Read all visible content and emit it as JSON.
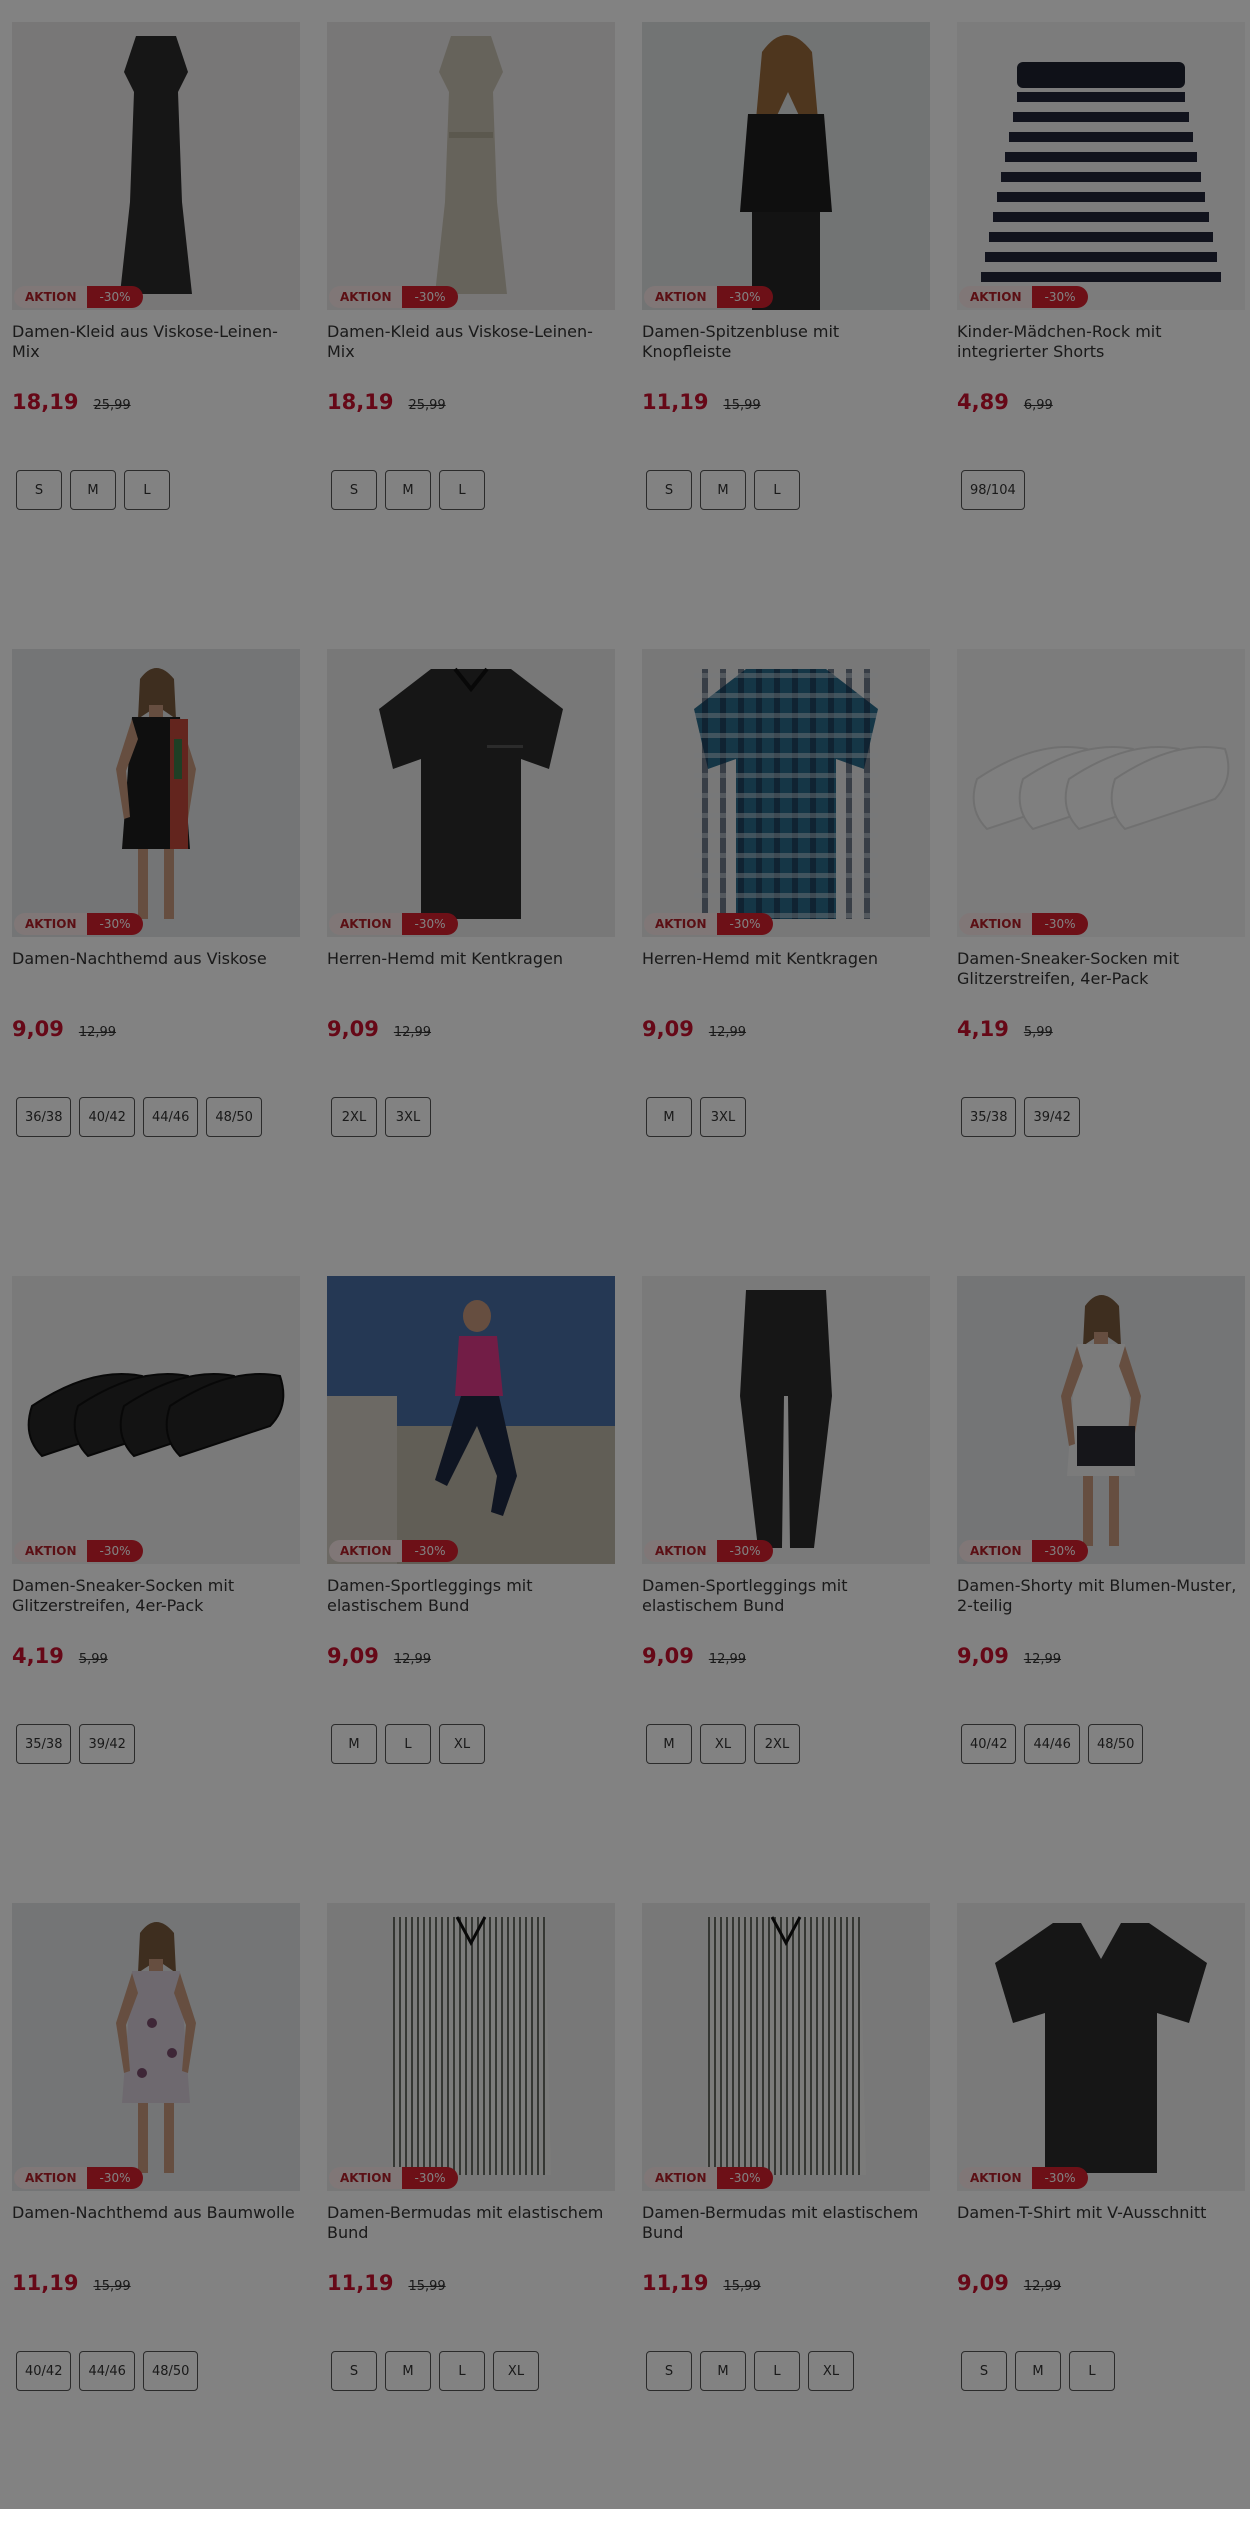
{
  "products": [
    {
      "title": "Damen-Kleid aus Viskose-Leinen-Mix",
      "badge": "AKTION",
      "discount": "-30%",
      "price": "18,19",
      "old_price": "25,99",
      "sizes": [
        "S",
        "M",
        "L"
      ],
      "image": {
        "icon": "black-dress-image",
        "bg": "#eceaea"
      }
    },
    {
      "title": "Damen-Kleid aus Viskose-Leinen-Mix",
      "badge": "AKTION",
      "discount": "-30%",
      "price": "18,19",
      "old_price": "25,99",
      "sizes": [
        "S",
        "M",
        "L"
      ],
      "image": {
        "icon": "beige-dress-image",
        "bg": "#eceaea"
      }
    },
    {
      "title": "Damen-Spitzenbluse mit Knopfleiste",
      "badge": "AKTION",
      "discount": "-30%",
      "price": "11,19",
      "old_price": "15,99",
      "sizes": [
        "S",
        "M",
        "L"
      ],
      "image": {
        "icon": "lace-blouse-model-image",
        "bg": "#dfe3e4"
      }
    },
    {
      "title": "Kinder-Mädchen-Rock mit integrierter Shorts",
      "badge": "AKTION",
      "discount": "-30%",
      "price": "4,89",
      "old_price": "6,99",
      "sizes": [
        "98/104"
      ],
      "image": {
        "icon": "striped-skirt-image",
        "bg": "#f3f3f3"
      }
    },
    {
      "title": "Damen-Nachthemd aus Viskose",
      "badge": "AKTION",
      "discount": "-30%",
      "price": "9,09",
      "old_price": "12,99",
      "sizes": [
        "36/38",
        "40/42",
        "44/46",
        "48/50"
      ],
      "image": {
        "icon": "nightdress-model-image",
        "bg": "#e3e6e7"
      }
    },
    {
      "title": "Herren-Hemd mit Kentkragen",
      "badge": "AKTION",
      "discount": "-30%",
      "price": "9,09",
      "old_price": "12,99",
      "sizes": [
        "2XL",
        "3XL"
      ],
      "image": {
        "icon": "black-shirt-image",
        "bg": "#ececec"
      }
    },
    {
      "title": "Herren-Hemd mit Kentkragen",
      "badge": "AKTION",
      "discount": "-30%",
      "price": "9,09",
      "old_price": "12,99",
      "sizes": [
        "M",
        "3XL"
      ],
      "image": {
        "icon": "plaid-shirt-image",
        "bg": "#ececec"
      }
    },
    {
      "title": "Damen-Sneaker-Socken mit Glitzerstreifen, 4er-Pack",
      "badge": "AKTION",
      "discount": "-30%",
      "price": "4,19",
      "old_price": "5,99",
      "sizes": [
        "35/38",
        "39/42"
      ],
      "image": {
        "icon": "white-socks-image",
        "bg": "#f3f3f3"
      }
    },
    {
      "title": "Damen-Sneaker-Socken mit Glitzerstreifen, 4er-Pack",
      "badge": "AKTION",
      "discount": "-30%",
      "price": "4,19",
      "old_price": "5,99",
      "sizes": [
        "35/38",
        "39/42"
      ],
      "image": {
        "icon": "black-socks-image",
        "bg": "#f0f0f0"
      }
    },
    {
      "title": "Damen-Sportleggings mit elastischem Bund",
      "badge": "AKTION",
      "discount": "-30%",
      "price": "9,09",
      "old_price": "12,99",
      "sizes": [
        "M",
        "L",
        "XL"
      ],
      "image": {
        "icon": "leggings-model-outdoor-image",
        "bg": "#6e86b0"
      }
    },
    {
      "title": "Damen-Sportleggings mit elastischem Bund",
      "badge": "AKTION",
      "discount": "-30%",
      "price": "9,09",
      "old_price": "12,99",
      "sizes": [
        "M",
        "XL",
        "2XL"
      ],
      "image": {
        "icon": "black-leggings-image",
        "bg": "#f0f0f0"
      }
    },
    {
      "title": "Damen-Shorty mit Blumen-Muster, 2-teilig",
      "badge": "AKTION",
      "discount": "-30%",
      "price": "9,09",
      "old_price": "12,99",
      "sizes": [
        "40/42",
        "44/46",
        "48/50"
      ],
      "image": {
        "icon": "shorty-model-image",
        "bg": "#e3e6e7"
      }
    },
    {
      "title": "Damen-Nachthemd aus Baumwolle",
      "badge": "AKTION",
      "discount": "-30%",
      "price": "11,19",
      "old_price": "15,99",
      "sizes": [
        "40/42",
        "44/46",
        "48/50"
      ],
      "image": {
        "icon": "floral-nightdress-model-image",
        "bg": "#e3e6e7"
      }
    },
    {
      "title": "Damen-Bermudas mit elastischem Bund",
      "badge": "AKTION",
      "discount": "-30%",
      "price": "11,19",
      "old_price": "15,99",
      "sizes": [
        "S",
        "M",
        "L",
        "XL"
      ],
      "image": {
        "icon": "striped-bermudas-image",
        "bg": "#ececec"
      }
    },
    {
      "title": "Damen-Bermudas mit elastischem Bund",
      "badge": "AKTION",
      "discount": "-30%",
      "price": "11,19",
      "old_price": "15,99",
      "sizes": [
        "S",
        "M",
        "L",
        "XL"
      ],
      "image": {
        "icon": "striped-bermudas-image",
        "bg": "#ececec"
      }
    },
    {
      "title": "Damen-T-Shirt mit V-Ausschnitt",
      "badge": "AKTION",
      "discount": "-30%",
      "price": "9,09",
      "old_price": "12,99",
      "sizes": [
        "S",
        "M",
        "L"
      ],
      "image": {
        "icon": "black-tshirt-image",
        "bg": "#f0f0f0"
      }
    }
  ],
  "colors": {
    "price": "#c8102e",
    "badge_discount": "#d6202e",
    "badge_aktion_bg": "#fbe9ea",
    "overlay": "rgba(0,0,0,0.49)"
  }
}
